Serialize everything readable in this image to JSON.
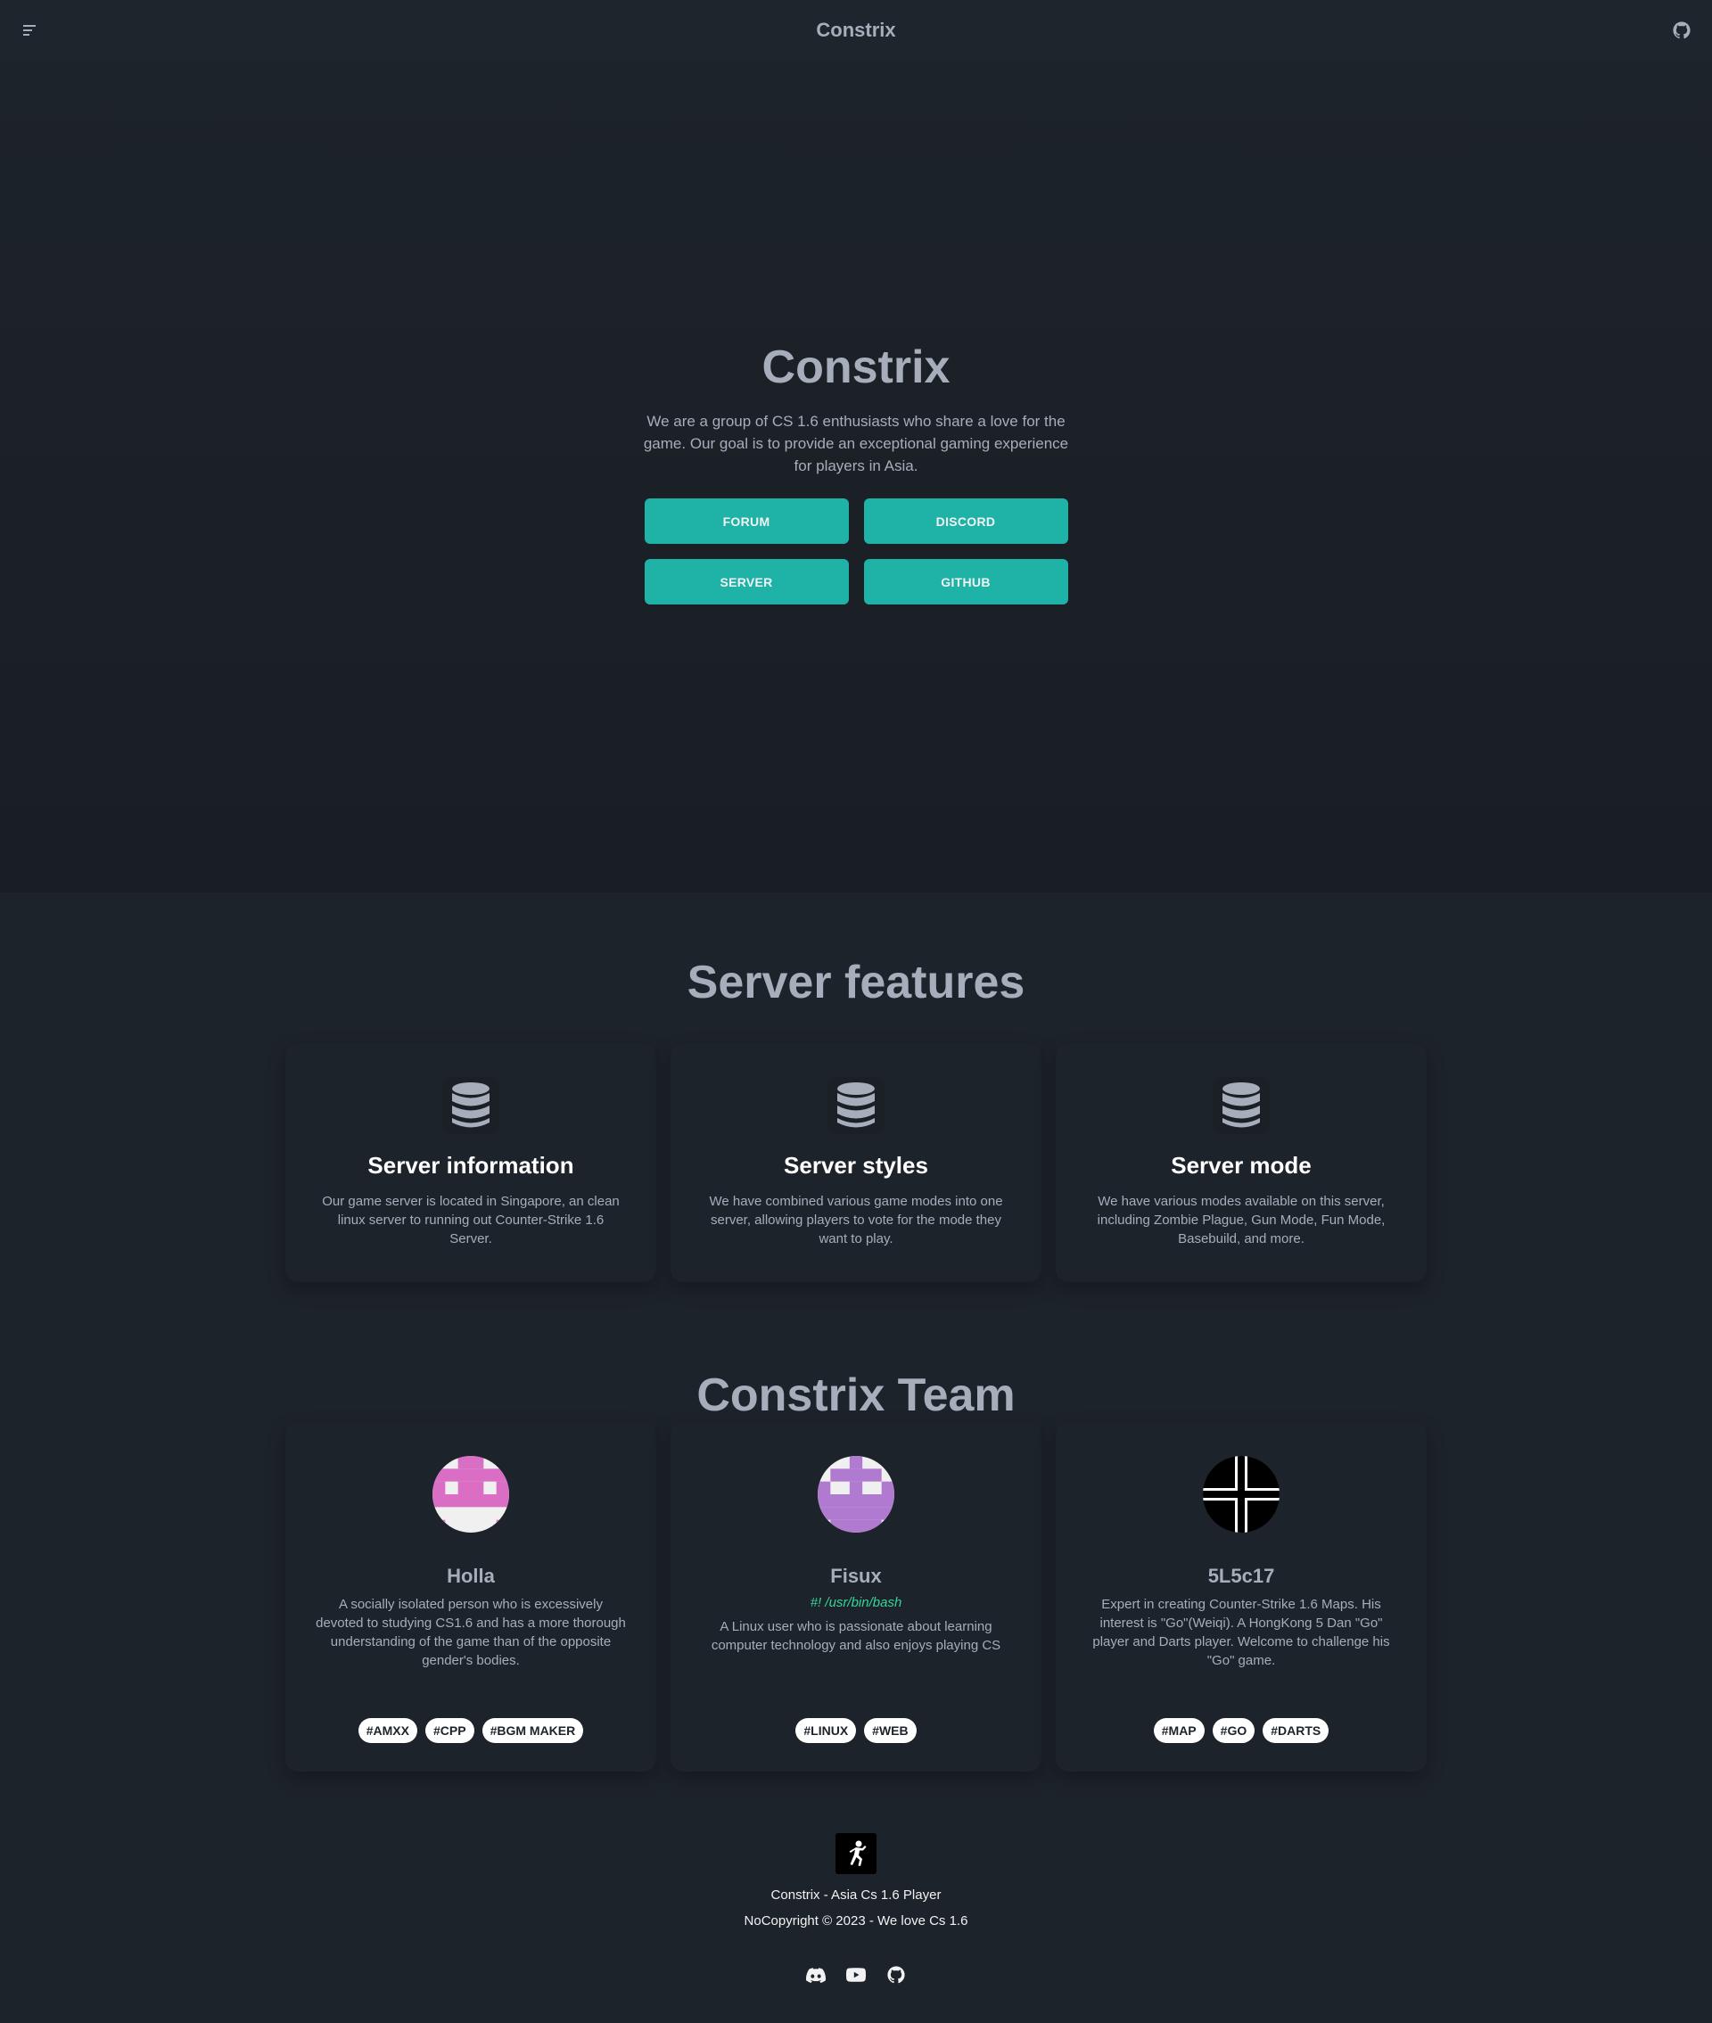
{
  "navbar": {
    "title": "Constrix",
    "menu_icon": "menu-icon",
    "github_icon": "github-icon"
  },
  "hero": {
    "title": "Constrix",
    "description": "We are a group of CS 1.6 enthusiasts who share a love for the game. Our goal is to provide an exceptional gaming experience for players in Asia.",
    "buttons": [
      "FORUM",
      "DISCORD",
      "SERVER",
      "GITHUB"
    ]
  },
  "features": {
    "title": "Server features",
    "cards": [
      {
        "icon": "database-icon",
        "title": "Server information",
        "description": "Our game server is located in Singapore, an clean linux server to running out Counter-Strike 1.6 Server."
      },
      {
        "icon": "database-icon",
        "title": "Server styles",
        "description": "We have combined various game modes into one server, allowing players to vote for the mode they want to play."
      },
      {
        "icon": "database-icon",
        "title": "Server mode",
        "description": "We have various modes available on this server, including Zombie Plague, Gun Mode, Fun Mode, Basebuild, and more."
      }
    ]
  },
  "team": {
    "title": "Constrix Team",
    "members": [
      {
        "name": "Holla",
        "subtitle": "",
        "description": "A socially isolated person who is excessively devoted to studying CS1.6 and has a more thorough understanding of the game than of the opposite gender's bodies.",
        "tags": [
          "#AMXX",
          "#CPP",
          "#BGM MAKER"
        ],
        "avatar": "identicon-pink"
      },
      {
        "name": "Fisux",
        "subtitle": "#! /usr/bin/bash",
        "description": "A Linux user who is passionate about learning computer technology and also enjoys playing CS",
        "tags": [
          "#LINUX",
          "#WEB"
        ],
        "avatar": "identicon-purple"
      },
      {
        "name": "5L5c17",
        "subtitle": "",
        "description": "Expert in creating Counter-Strike 1.6 Maps. His interest is \"Go\"(Weiqi). A HongKong 5 Dan \"Go\" player and Darts player. Welcome to challenge his \"Go\" game.",
        "tags": [
          "#MAP",
          "#GO",
          "#DARTS"
        ],
        "avatar": "iron-cross"
      }
    ]
  },
  "footer": {
    "logo_icon": "counter-strike-logo-icon",
    "line1": "Constrix - Asia Cs 1.6 Player",
    "line2": "NoCopyright © 2023 - We love Cs 1.6",
    "socials": [
      "discord-icon",
      "youtube-icon",
      "github-icon"
    ]
  },
  "colors": {
    "background": "#1d232a",
    "accent": "#1fb2a6",
    "text": "#a6adbb",
    "subtitle_green": "#36d399"
  }
}
